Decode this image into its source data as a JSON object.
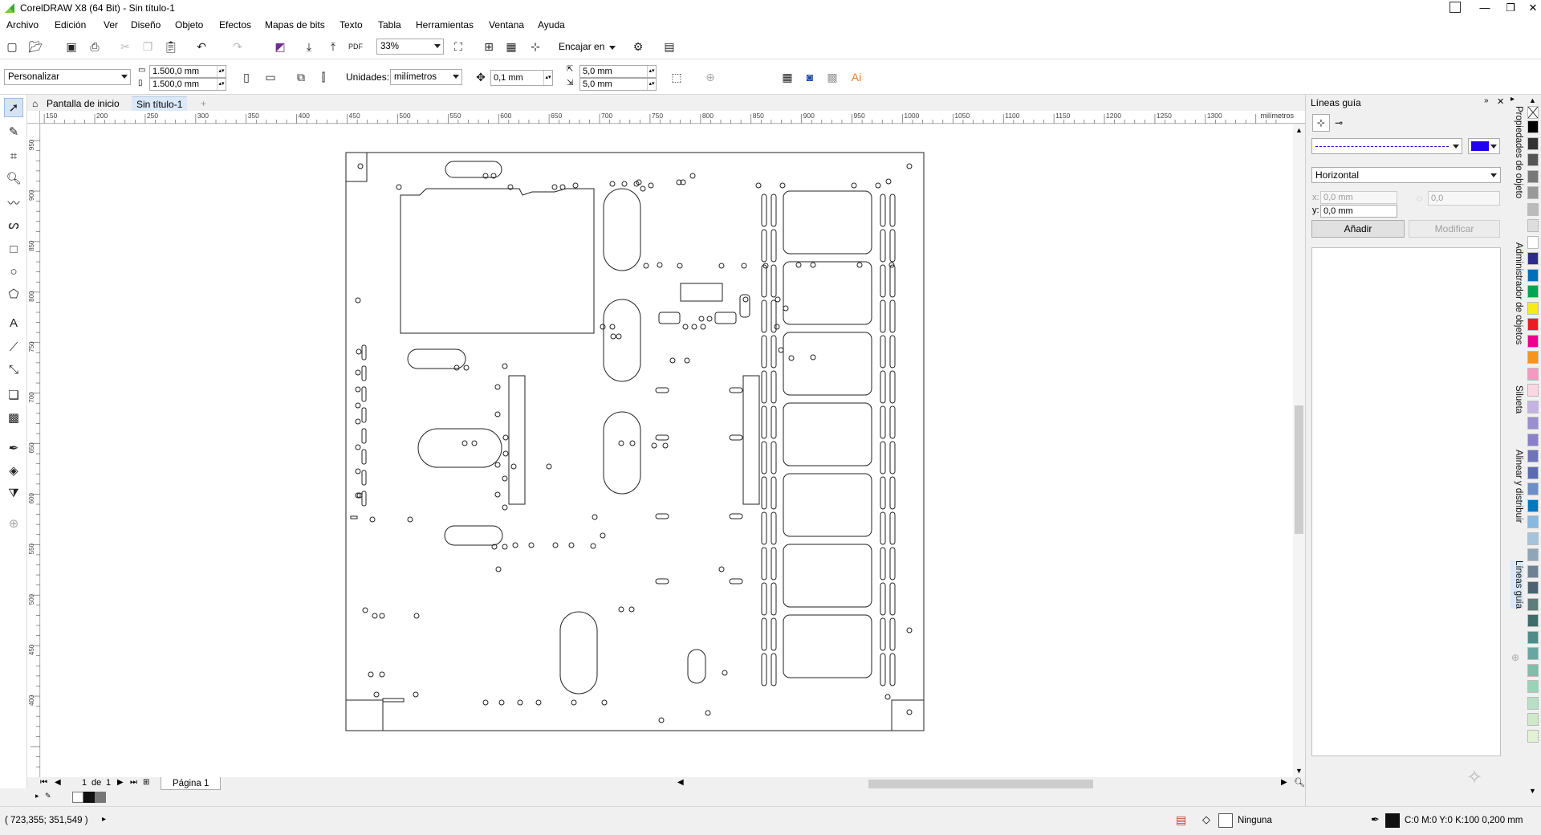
{
  "window": {
    "title": "CorelDRAW X8 (64 Bit) - Sin título-1",
    "controls": [
      "—",
      "❐",
      "✕"
    ]
  },
  "menu": [
    "Archivo",
    "Edición",
    "Ver",
    "Diseño",
    "Objeto",
    "Efectos",
    "Mapas de bits",
    "Texto",
    "Tabla",
    "Herramientas",
    "Ventana",
    "Ayuda"
  ],
  "standard_toolbar": {
    "zoom_value": "33%",
    "snap_label": "Encajar en"
  },
  "property_bar": {
    "page_size": "Personalizar",
    "width": "1.500,0 mm",
    "height": "1.500,0 mm",
    "units_label": "Unidades:",
    "units_value": "milímetros",
    "nudge": "0,1 mm",
    "dup_x": "5,0 mm",
    "dup_y": "5,0 mm"
  },
  "doc_tabs": {
    "home": "Pantalla de inicio",
    "active": "Sin título-1",
    "add": "+"
  },
  "ruler": {
    "h_ticks": [
      "150",
      "200",
      "250",
      "300",
      "350",
      "400",
      "450",
      "500",
      "550",
      "600",
      "650",
      "700",
      "750",
      "800",
      "850",
      "900",
      "950",
      "1000",
      "1050",
      "1100",
      "1150",
      "1200",
      "1250",
      "1300"
    ],
    "h_unit": "milímetros",
    "v_ticks": [
      "950",
      "900",
      "850",
      "800",
      "750",
      "700",
      "650",
      "600",
      "550",
      "500",
      "450",
      "400"
    ]
  },
  "page_nav": {
    "current": "1",
    "of_label": "de",
    "total": "1",
    "page_tab": "Página 1"
  },
  "status": {
    "coords": "( 723,355; 351,549 )",
    "fill_label": "Ninguna",
    "outline_label": "C:0 M:0 Y:0 K:100  0,200 mm"
  },
  "docker": {
    "title": "Líneas guía",
    "orientation": "Horizontal",
    "x_value": "0,0 mm",
    "y_value": "0,0 mm",
    "x_label": "x:",
    "y_label": "y:",
    "angle_value": "0,0",
    "add_button": "Añadir",
    "modify_button": "Modificar",
    "guide_color": "#2200ee"
  },
  "docker_tabs": [
    "Propiedades de objeto",
    "Administrador de objetos",
    "Silueta",
    "Alinear y distribuir",
    "Líneas guía"
  ],
  "palette_colors": [
    "#000000",
    "#333333",
    "#555555",
    "#777777",
    "#999999",
    "#bbbbbb",
    "#dddddd",
    "#ffffff",
    "#2e2b8f",
    "#006fb9",
    "#00a651",
    "#f6eb16",
    "#ed1c24",
    "#ec008c",
    "#f7941d",
    "#f49ac1",
    "#fbd7e4",
    "#c5b4e3",
    "#9a8ed0",
    "#8a80c8",
    "#6f73b9",
    "#5b6bb3",
    "#6b8fc6",
    "#0078bf",
    "#86b8e0",
    "#a6c3dc",
    "#8fa6b8",
    "#6f8293",
    "#4d6170",
    "#5d7d7a",
    "#3f6b6a",
    "#4f8c89",
    "#6aa6a1",
    "#7fbfa9",
    "#9cd3b8",
    "#b7e0c4",
    "#cfe9c9",
    "#e3f2d4"
  ]
}
